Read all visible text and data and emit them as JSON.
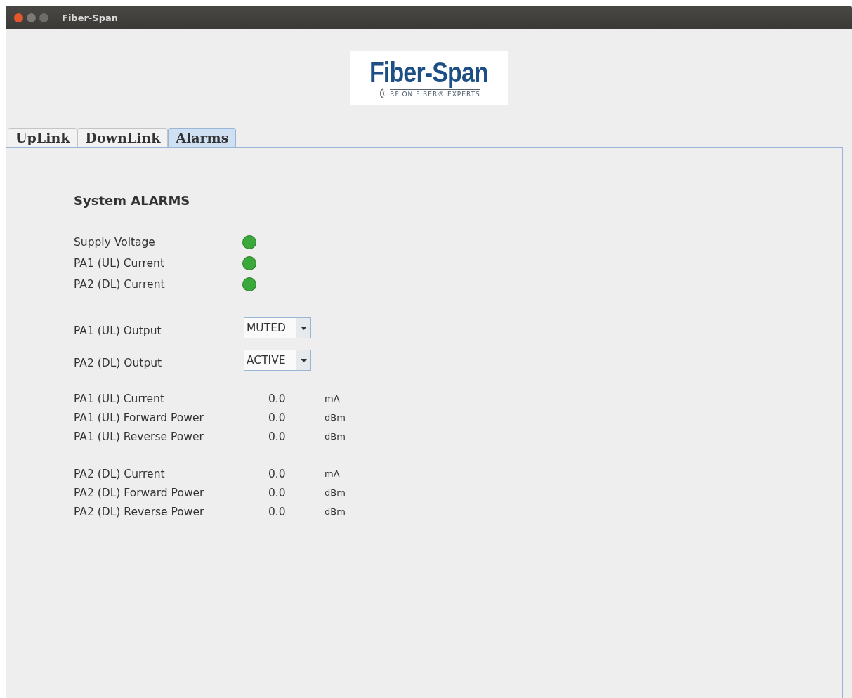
{
  "window": {
    "title": "Fiber-Span"
  },
  "logo": {
    "name": "Fiber-Span",
    "tagline": "RF ON FIBER® EXPERTS"
  },
  "tabs": [
    {
      "label": "UpLink",
      "selected": false
    },
    {
      "label": "DownLink",
      "selected": false
    },
    {
      "label": "Alarms",
      "selected": true
    }
  ],
  "panel": {
    "title": "System ALARMS",
    "alarms": [
      {
        "label": "Supply Voltage",
        "color": "#3aa83a"
      },
      {
        "label": "PA1 (UL) Current",
        "color": "#3aa83a"
      },
      {
        "label": "PA2 (DL) Current",
        "color": "#3aa83a"
      }
    ],
    "outputs": [
      {
        "label": "PA1 (UL) Output",
        "value": "MUTED"
      },
      {
        "label": "PA2 (DL) Output",
        "value": "ACTIVE"
      }
    ],
    "measurement_groups": [
      [
        {
          "label": "PA1 (UL) Current",
          "value": "0.0",
          "unit": "mA"
        },
        {
          "label": "PA1 (UL) Forward Power",
          "value": "0.0",
          "unit": "dBm"
        },
        {
          "label": "PA1 (UL) Reverse Power",
          "value": "0.0",
          "unit": "dBm"
        }
      ],
      [
        {
          "label": "PA2 (DL) Current",
          "value": "0.0",
          "unit": "mA"
        },
        {
          "label": "PA2 (DL) Forward Power",
          "value": "0.0",
          "unit": "dBm"
        },
        {
          "label": "PA2 (DL) Reverse Power",
          "value": "0.0",
          "unit": "dBm"
        }
      ]
    ]
  }
}
